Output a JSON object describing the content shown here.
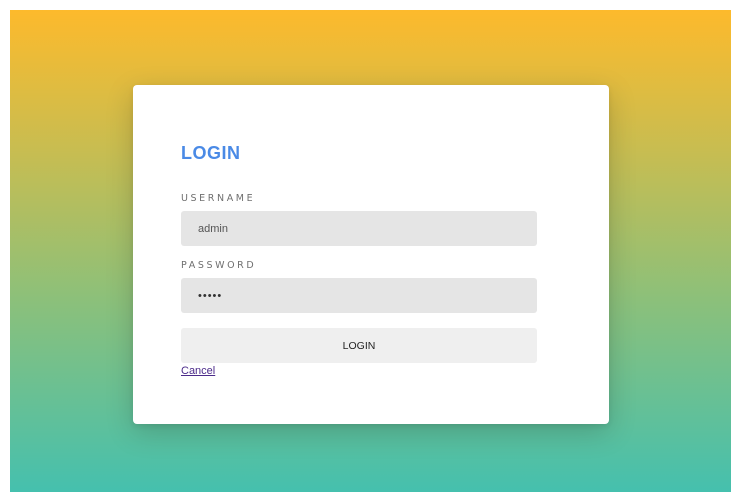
{
  "login_form": {
    "title": "LOGIN",
    "username_label": "USERNAME",
    "username_value": "admin",
    "password_label": "PASSWORD",
    "password_value": "admin",
    "submit_label": "LOGIN",
    "cancel_label": "Cancel"
  },
  "colors": {
    "title": "#4a8ae6",
    "gradient_top": "#fdba2c",
    "gradient_bottom": "#45c0ae",
    "input_background": "#e5e5e5",
    "button_background": "#efefef",
    "link": "#4b2a8a"
  }
}
